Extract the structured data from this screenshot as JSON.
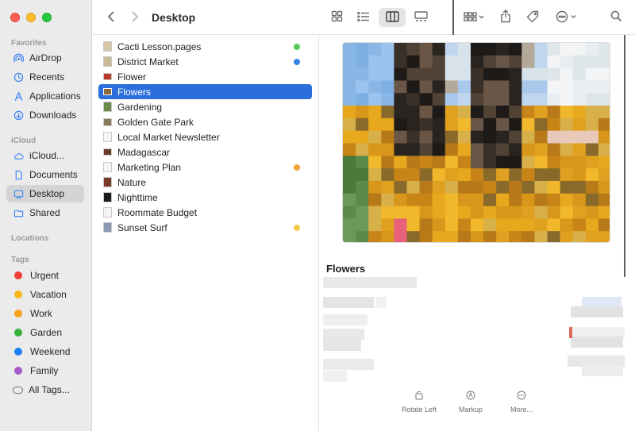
{
  "toolbar": {
    "title": "Desktop"
  },
  "sidebar": {
    "favorites_title": "Favorites",
    "favorites": [
      {
        "label": "AirDrop",
        "icon": "airdrop-icon"
      },
      {
        "label": "Recents",
        "icon": "clock-icon"
      },
      {
        "label": "Applications",
        "icon": "applications-icon"
      },
      {
        "label": "Downloads",
        "icon": "download-icon"
      }
    ],
    "icloud_title": "iCloud",
    "icloud": [
      {
        "label": "iCloud...",
        "icon": "cloud-icon"
      },
      {
        "label": "Documents",
        "icon": "document-icon"
      },
      {
        "label": "Desktop",
        "icon": "desktop-icon"
      },
      {
        "label": "Shared",
        "icon": "shared-folder-icon"
      }
    ],
    "locations_title": "Locations",
    "tags_title": "Tags",
    "tags": [
      {
        "label": "Urgent",
        "color": "#f33b36"
      },
      {
        "label": "Vacation",
        "color": "#f5b919"
      },
      {
        "label": "Work",
        "color": "#f7a11a"
      },
      {
        "label": "Garden",
        "color": "#34b33a"
      },
      {
        "label": "Weekend",
        "color": "#1f81f1"
      },
      {
        "label": "Family",
        "color": "#a35ac8"
      },
      {
        "label": "All Tags...",
        "color": ""
      }
    ]
  },
  "files": [
    {
      "name": "Cacti Lesson.pages",
      "tag": "#5ac85a",
      "thumb": "#d8c8a8"
    },
    {
      "name": "District Market",
      "tag": "#3a83e6",
      "thumb": "#c8b898"
    },
    {
      "name": "Flower",
      "tag": "",
      "thumb": "#b83a2a"
    },
    {
      "name": "Flowers",
      "tag": "",
      "thumb": "#8a6a3a"
    },
    {
      "name": "Gardening",
      "tag": "",
      "thumb": "#6a8a4a"
    },
    {
      "name": "Golden Gate Park",
      "tag": "",
      "thumb": "#8a7a5a"
    },
    {
      "name": "Local Market Newsletter",
      "tag": "",
      "thumb": "#f4f4f4"
    },
    {
      "name": "Madagascar",
      "tag": "",
      "thumb": "#6a3a2a"
    },
    {
      "name": "Marketing Plan",
      "tag": "#f2a33a",
      "thumb": "#f4f4f4"
    },
    {
      "name": "Nature",
      "tag": "",
      "thumb": "#7a3a2a"
    },
    {
      "name": "Nighttime",
      "tag": "",
      "thumb": "#1a1a1a"
    },
    {
      "name": "Roommate Budget",
      "tag": "",
      "thumb": "#f4f4f4"
    },
    {
      "name": "Sunset Surf",
      "tag": "#f5c94a",
      "thumb": "#8a9ab0"
    }
  ],
  "preview": {
    "name": "Flowers",
    "actions": [
      {
        "label": "Rotate Left",
        "icon": "rotate-left-icon"
      },
      {
        "label": "Markup",
        "icon": "markup-icon"
      },
      {
        "label": "More...",
        "icon": "more-icon"
      }
    ]
  }
}
